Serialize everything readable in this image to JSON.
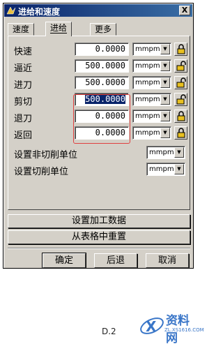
{
  "window": {
    "title": "进给和速度",
    "close_label": "X"
  },
  "tabs": [
    {
      "label": "速度",
      "active": false
    },
    {
      "label": "进给",
      "active": true
    },
    {
      "label": "更多",
      "active": false
    }
  ],
  "rows": [
    {
      "label": "快速",
      "value": "0.0000",
      "unit": "mmpm",
      "selected": false
    },
    {
      "label": "逼近",
      "value": "500.0000",
      "unit": "mmpm",
      "selected": false
    },
    {
      "label": "进刀",
      "value": "500.0000",
      "unit": "mmpm",
      "selected": false
    },
    {
      "label": "剪切",
      "value": "500.0000",
      "unit": "mmpm",
      "selected": true
    },
    {
      "label": "退刀",
      "value": "0.0000",
      "unit": "mmpm",
      "selected": false
    },
    {
      "label": "返回",
      "value": "0.0000",
      "unit": "mmpm",
      "selected": false
    }
  ],
  "settings": [
    {
      "label": "设置非切削单位",
      "unit": "mmpm"
    },
    {
      "label": "设置切削单位",
      "unit": "mmpm"
    }
  ],
  "actions": {
    "set_machining_data": "设置加工数据",
    "reset_from_table": "从表格中重置"
  },
  "buttons": {
    "ok": "确定",
    "back": "后退",
    "cancel": "取消"
  },
  "caption": "D.2",
  "watermark": {
    "name": "资料网",
    "url": "ZL.XS1616.COM"
  },
  "colors": {
    "titlebar": "#0a246a",
    "dialog_bg": "#d4d0c8",
    "annotation": "#e04040",
    "watermark": "#3a76c8"
  }
}
